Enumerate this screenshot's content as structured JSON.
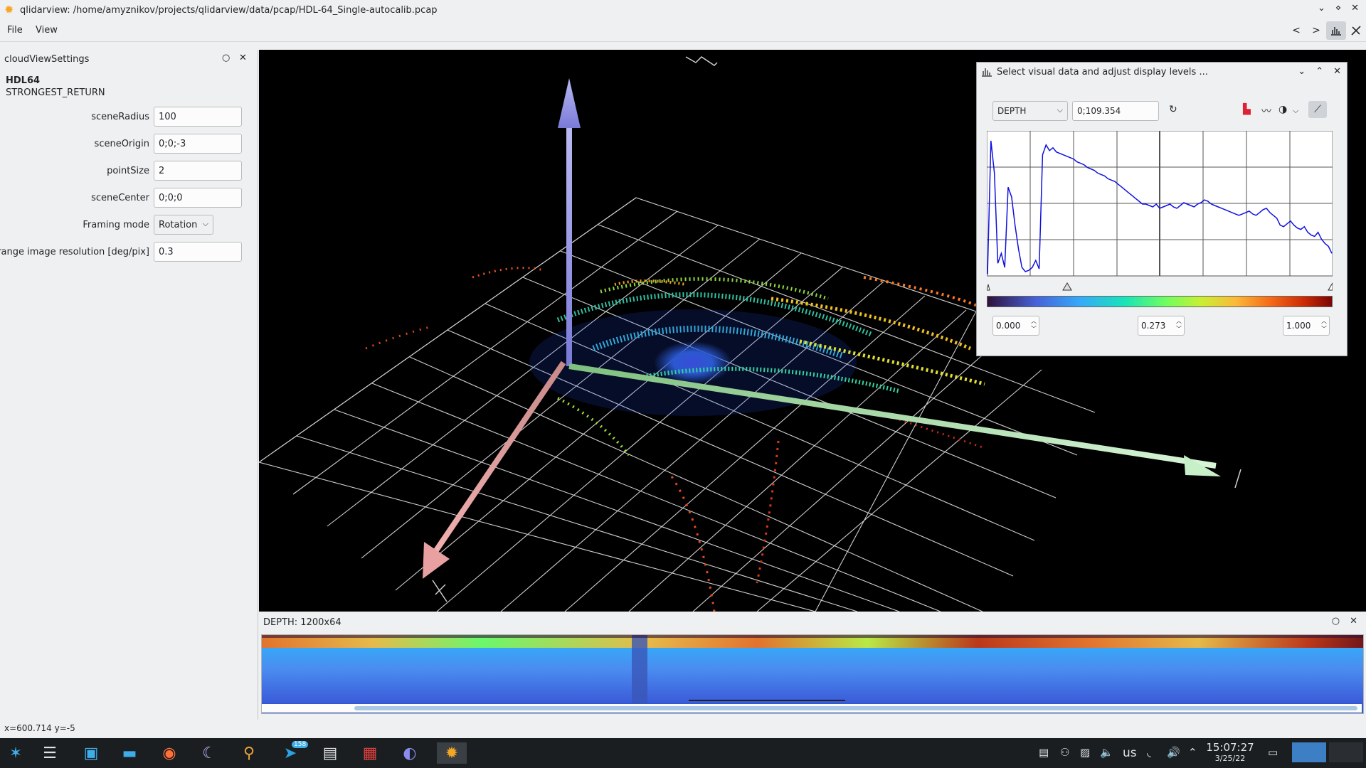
{
  "window": {
    "title": "qlidarview: /home/amyznikov/projects/qlidarview/data/pcap/HDL-64_Single-autocalib.pcap",
    "buttons": [
      "⌄",
      "⋄",
      "✕"
    ]
  },
  "menu": {
    "file": "File",
    "view": "View"
  },
  "toolbar": {
    "prev": "<",
    "next": ">",
    "levels_icon": "histogram-icon",
    "tools_icon": "tools-icon"
  },
  "settings_panel": {
    "title": "cloudViewSettings",
    "device": "HDL64",
    "mode": "STRONGEST_RETURN",
    "fields": [
      {
        "label": "sceneRadius",
        "value": "100"
      },
      {
        "label": "sceneOrigin",
        "value": "0;0;-3"
      },
      {
        "label": "pointSize",
        "value": "2"
      },
      {
        "label": "sceneCenter",
        "value": "0;0;0"
      },
      {
        "label": "Framing mode",
        "value": "Rotation"
      },
      {
        "label": "range image resolution [deg/pix]",
        "value": "0.3"
      }
    ]
  },
  "levels_dialog": {
    "title": "Select visual data and adjust display levels ...",
    "data_type": "DEPTH",
    "range": "0;109.354",
    "min": "0.000",
    "mid": "0.273",
    "max": "1.000",
    "histogram": [
      0.0,
      0.95,
      0.72,
      0.08,
      0.15,
      0.05,
      0.62,
      0.55,
      0.35,
      0.18,
      0.05,
      0.02,
      0.03,
      0.05,
      0.1,
      0.04,
      0.85,
      0.92,
      0.88,
      0.9,
      0.87,
      0.86,
      0.85,
      0.84,
      0.83,
      0.82,
      0.8,
      0.79,
      0.78,
      0.76,
      0.75,
      0.74,
      0.72,
      0.71,
      0.7,
      0.68,
      0.67,
      0.66,
      0.64,
      0.62,
      0.6,
      0.58,
      0.56,
      0.54,
      0.52,
      0.5,
      0.5,
      0.49,
      0.48,
      0.5,
      0.47,
      0.48,
      0.49,
      0.5,
      0.48,
      0.47,
      0.49,
      0.51,
      0.5,
      0.49,
      0.48,
      0.5,
      0.51,
      0.53,
      0.52,
      0.5,
      0.49,
      0.48,
      0.47,
      0.46,
      0.45,
      0.44,
      0.43,
      0.42,
      0.43,
      0.44,
      0.45,
      0.43,
      0.42,
      0.44,
      0.46,
      0.47,
      0.44,
      0.42,
      0.4,
      0.35,
      0.34,
      0.36,
      0.38,
      0.35,
      0.33,
      0.32,
      0.34,
      0.3,
      0.28,
      0.27,
      0.3,
      0.25,
      0.22,
      0.2,
      0.15
    ]
  },
  "range_image": {
    "title": "DEPTH: 1200x64"
  },
  "status": {
    "coords": "x=600.714 y=-5"
  },
  "taskbar": {
    "telegram_badge": "158",
    "lang": "us",
    "time": "15:07:27",
    "date": "3/25/22"
  }
}
